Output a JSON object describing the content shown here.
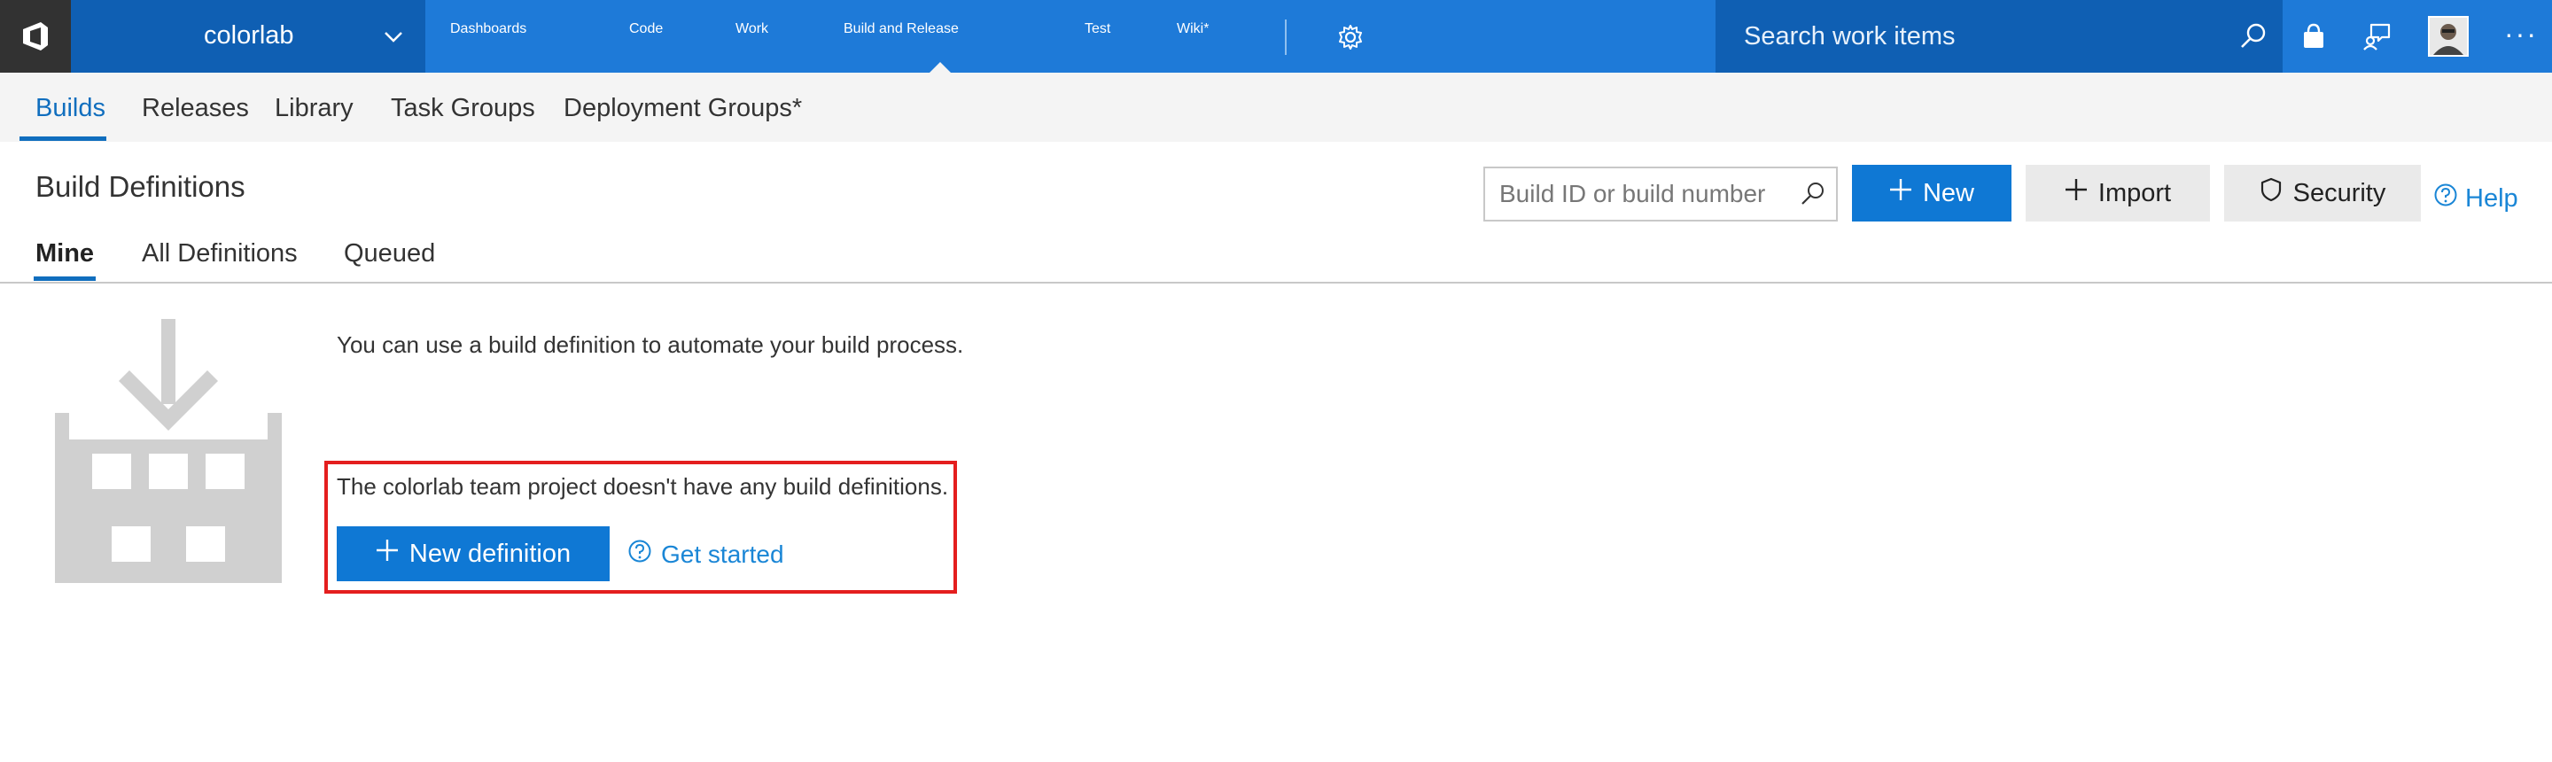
{
  "topbar": {
    "project_name": "colorlab",
    "nav": [
      "Dashboards",
      "Code",
      "Work",
      "Build and Release",
      "Test",
      "Wiki*"
    ],
    "active_nav": "Build and Release",
    "search_placeholder": "Search work items",
    "icons": [
      "vsts-logo-icon",
      "chevron-down-icon",
      "gear-icon",
      "search-icon",
      "shopping-bag-icon",
      "feedback-icon",
      "avatar",
      "more-icon"
    ],
    "more_label": "···"
  },
  "subnav": {
    "items": [
      "Builds",
      "Releases",
      "Library",
      "Task Groups",
      "Deployment Groups*"
    ],
    "active": "Builds"
  },
  "header": {
    "title": "Build Definitions",
    "tabs": [
      "Mine",
      "All Definitions",
      "Queued"
    ],
    "active_tab": "Mine",
    "search_placeholder": "Build ID or build number",
    "new_label": "New",
    "import_label": "Import",
    "security_label": "Security",
    "help_label": "Help"
  },
  "content": {
    "intro": "You can use a build definition to automate your build process.",
    "empty_message": "The colorlab team project doesn't have any build definitions.",
    "new_definition_label": "New definition",
    "get_started_label": "Get started"
  },
  "colors": {
    "topbar": "#1e7ad8",
    "topbar_dark": "#0f5fb3",
    "primary_button": "#0f78d4",
    "highlight_box": "#e41e1e",
    "illustration": "#d0d0d0"
  }
}
